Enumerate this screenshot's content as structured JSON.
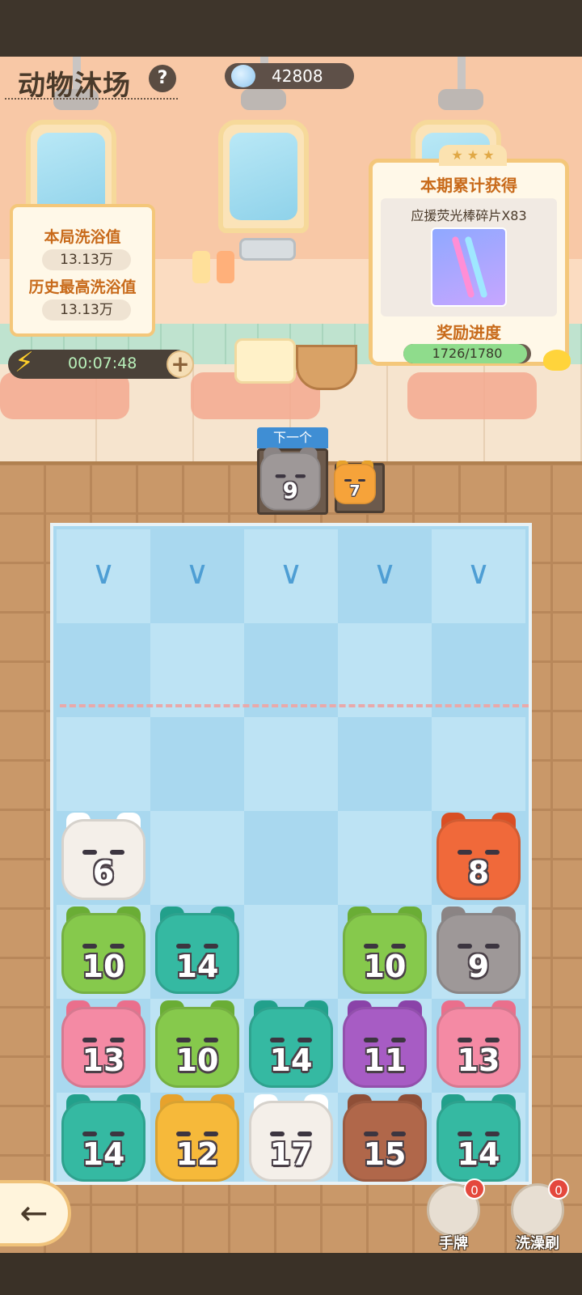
{
  "header": {
    "title": "动物沐场",
    "help_icon": "?",
    "currency_value": "42808"
  },
  "score_panel": {
    "current_label": "本局洗浴值",
    "current_value": "13.13万",
    "best_label": "历史最高洗浴值",
    "best_value": "13.13万"
  },
  "timer": {
    "time": "00:07:48",
    "plus_label": "+"
  },
  "reward_panel": {
    "title": "本期累计获得",
    "item_name": "应援荧光棒碎片X83",
    "progress_label": "奖励进度",
    "progress_text": "1726/1780",
    "progress_current": 1726,
    "progress_max": 1780
  },
  "next_queue": {
    "label": "下一个",
    "pieces": [
      {
        "animal": "koala",
        "number": "9"
      },
      {
        "animal": "tiger",
        "number": "7"
      }
    ]
  },
  "drop_arrows": [
    "∨",
    "∨",
    "∨",
    "∨",
    "∨"
  ],
  "board": {
    "pieces": [
      {
        "animal": "sheep",
        "number": "6",
        "color": "#f4efe9",
        "col": 0,
        "row": 3
      },
      {
        "animal": "fox",
        "number": "8",
        "color": "#f0693a",
        "col": 4,
        "row": 3
      },
      {
        "animal": "frog",
        "number": "10",
        "color": "#86c94c",
        "col": 0,
        "row": 4
      },
      {
        "animal": "parrot",
        "number": "14",
        "color": "#35b9a2",
        "col": 1,
        "row": 4
      },
      {
        "animal": "frog",
        "number": "10",
        "color": "#86c94c",
        "col": 3,
        "row": 4
      },
      {
        "animal": "koala",
        "number": "9",
        "color": "#9e9898",
        "col": 4,
        "row": 4
      },
      {
        "animal": "pig",
        "number": "13",
        "color": "#f48aa4",
        "col": 0,
        "row": 5
      },
      {
        "animal": "frog",
        "number": "10",
        "color": "#86c94c",
        "col": 1,
        "row": 5
      },
      {
        "animal": "parrot",
        "number": "14",
        "color": "#35b9a2",
        "col": 2,
        "row": 5
      },
      {
        "animal": "owl",
        "number": "11",
        "color": "#a75cc4",
        "col": 3,
        "row": 5
      },
      {
        "animal": "pig",
        "number": "13",
        "color": "#f48aa4",
        "col": 4,
        "row": 5
      },
      {
        "animal": "parrot",
        "number": "14",
        "color": "#35b9a2",
        "col": 0,
        "row": 6
      },
      {
        "animal": "cat",
        "number": "12",
        "color": "#f6b93a",
        "col": 1,
        "row": 6
      },
      {
        "animal": "sheep",
        "number": "17",
        "color": "#f4efe9",
        "col": 2,
        "row": 6
      },
      {
        "animal": "bear",
        "number": "15",
        "color": "#b0674a",
        "col": 3,
        "row": 6
      },
      {
        "animal": "parrot",
        "number": "14",
        "color": "#35b9a2",
        "col": 4,
        "row": 6
      }
    ]
  },
  "footer": {
    "back_icon": "←",
    "tools": [
      {
        "label": "手牌",
        "count": "0",
        "icon": "bracelet-icon"
      },
      {
        "label": "洗澡刷",
        "count": "0",
        "icon": "bath-brush-icon"
      }
    ]
  }
}
